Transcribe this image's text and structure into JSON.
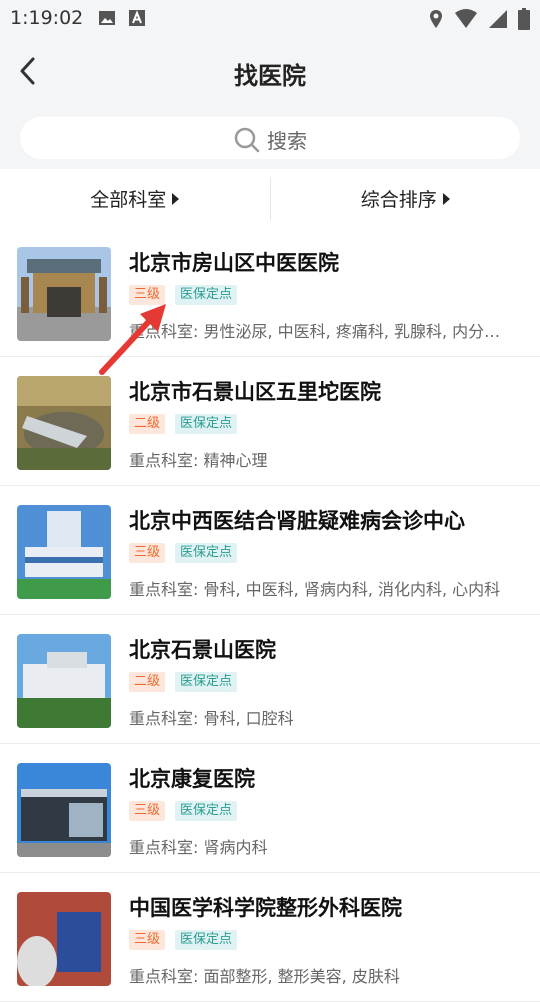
{
  "status": {
    "time": "1:19:02"
  },
  "header": {
    "title": "找医院"
  },
  "search": {
    "placeholder": "搜索"
  },
  "filters": {
    "department": "全部科室",
    "sort": "综合排序"
  },
  "hospitals": [
    {
      "name": "北京市房山区中医医院",
      "level": "三级",
      "insurance": "医保定点",
      "departments": "重点科室: 男性泌尿, 中医科, 疼痛科, 乳腺科, 内分…"
    },
    {
      "name": "北京市石景山区五里坨医院",
      "level": "二级",
      "insurance": "医保定点",
      "departments": "重点科室: 精神心理"
    },
    {
      "name": "北京中西医结合肾脏疑难病会诊中心",
      "level": "三级",
      "insurance": "医保定点",
      "departments": "重点科室: 骨科, 中医科, 肾病内科, 消化内科, 心内科"
    },
    {
      "name": "北京石景山医院",
      "level": "二级",
      "insurance": "医保定点",
      "departments": "重点科室: 骨科, 口腔科"
    },
    {
      "name": "北京康复医院",
      "level": "三级",
      "insurance": "医保定点",
      "departments": "重点科室: 肾病内科"
    },
    {
      "name": "中国医学科学院整形外科医院",
      "level": "三级",
      "insurance": "医保定点",
      "departments": "重点科室: 面部整形, 整形美容, 皮肤科"
    }
  ],
  "colors": {
    "level_text": "#f06a2e",
    "level_bg": "#fde7dc",
    "insurance_text": "#2a9d8f",
    "insurance_bg": "#e1f2f4",
    "annotation_arrow": "#e53935"
  }
}
